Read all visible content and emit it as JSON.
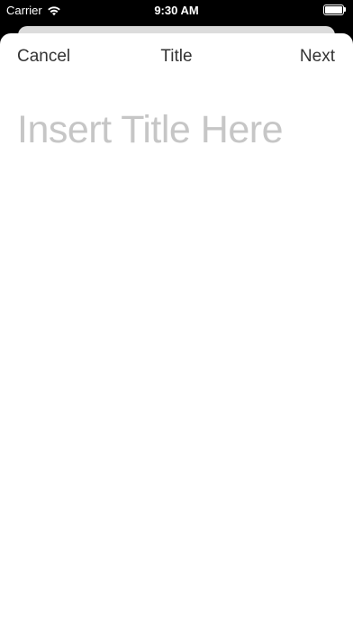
{
  "status_bar": {
    "carrier": "Carrier",
    "time": "9:30 AM",
    "wifi_icon": "wifi-icon",
    "battery_icon": "battery-icon"
  },
  "nav": {
    "cancel_label": "Cancel",
    "title": "Title",
    "next_label": "Next"
  },
  "editor": {
    "title_placeholder": "Insert Title Here",
    "title_value": ""
  },
  "colors": {
    "status_bar_bg": "#000000",
    "sheet_bg": "#ffffff",
    "nav_text": "#333333",
    "placeholder_text": "#c6c6c6"
  }
}
